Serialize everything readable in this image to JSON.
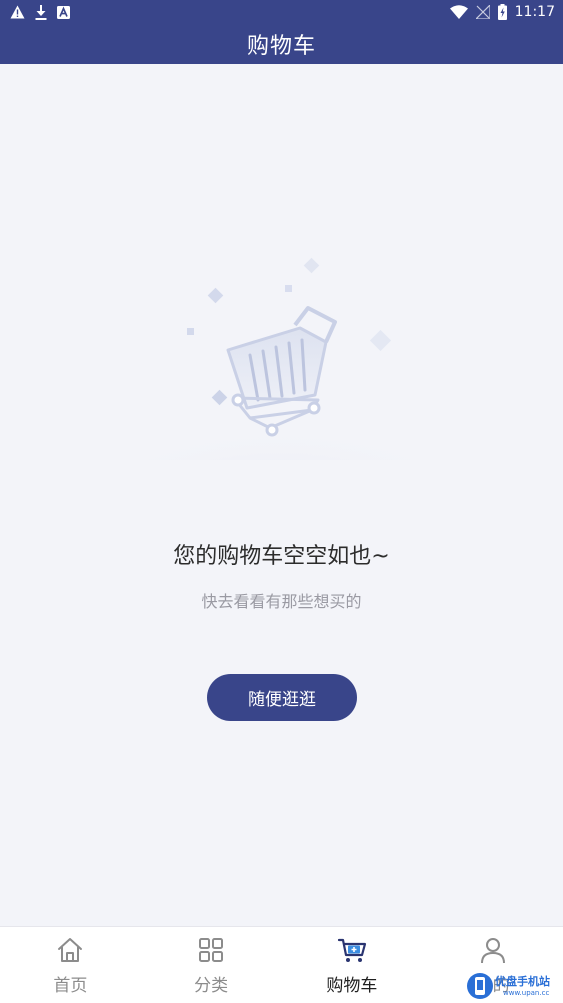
{
  "status_bar": {
    "time": "11:17",
    "left_icons": [
      "warning-icon",
      "download-icon",
      "font-a-icon"
    ],
    "right_icons": [
      "wifi-icon",
      "no-signal-icon",
      "battery-charging-icon"
    ]
  },
  "header": {
    "title": "购物车"
  },
  "empty_state": {
    "illustration": "empty-cart-illustration",
    "title": "您的购物车空空如也~",
    "subtitle": "快去看看有那些想买的",
    "button_label": "随便逛逛"
  },
  "bottom_nav": {
    "active_index": 2,
    "items": [
      {
        "label": "首页",
        "icon": "home-icon"
      },
      {
        "label": "分类",
        "icon": "grid-icon"
      },
      {
        "label": "购物车",
        "icon": "cart-icon"
      },
      {
        "label": "我的",
        "icon": "user-icon"
      }
    ]
  },
  "watermark": {
    "text": "优盘手机站",
    "sub": "www.upan.cc"
  },
  "colors": {
    "primary": "#39458a",
    "background": "#f3f4f9",
    "nav_inactive": "#8c8c8c",
    "cart_accent": "#3b8de0"
  }
}
